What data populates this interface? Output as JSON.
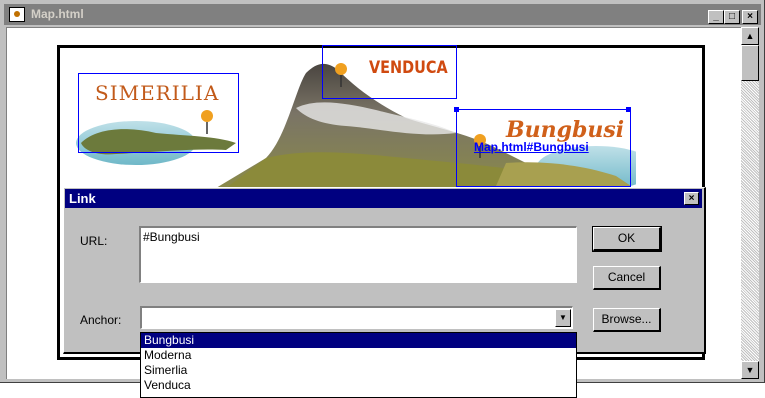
{
  "window": {
    "title": "Map.html",
    "controls": {
      "minimize": "_",
      "maximize": "□",
      "close": "×"
    }
  },
  "map": {
    "labels": {
      "simerilia": "SIMERILIA",
      "venduca": "VENDUCA",
      "bungbusi": "Bungbusi"
    },
    "selected_link_text": "Map.html#Bungbusi"
  },
  "dialog": {
    "title": "Link",
    "close": "×",
    "url_label": "URL:",
    "url_value": "#Bungbusi",
    "anchor_label": "Anchor:",
    "anchor_value": "",
    "buttons": {
      "ok": "OK",
      "cancel": "Cancel",
      "browse": "Browse..."
    },
    "anchor_options": [
      "Bungbusi",
      "Moderna",
      "Simerlia",
      "Venduca"
    ],
    "selected_option": "Bungbusi"
  },
  "colors": {
    "dialog_title_bg": "#000080",
    "hotspot_border": "#0000ff",
    "link": "#0000ff"
  }
}
